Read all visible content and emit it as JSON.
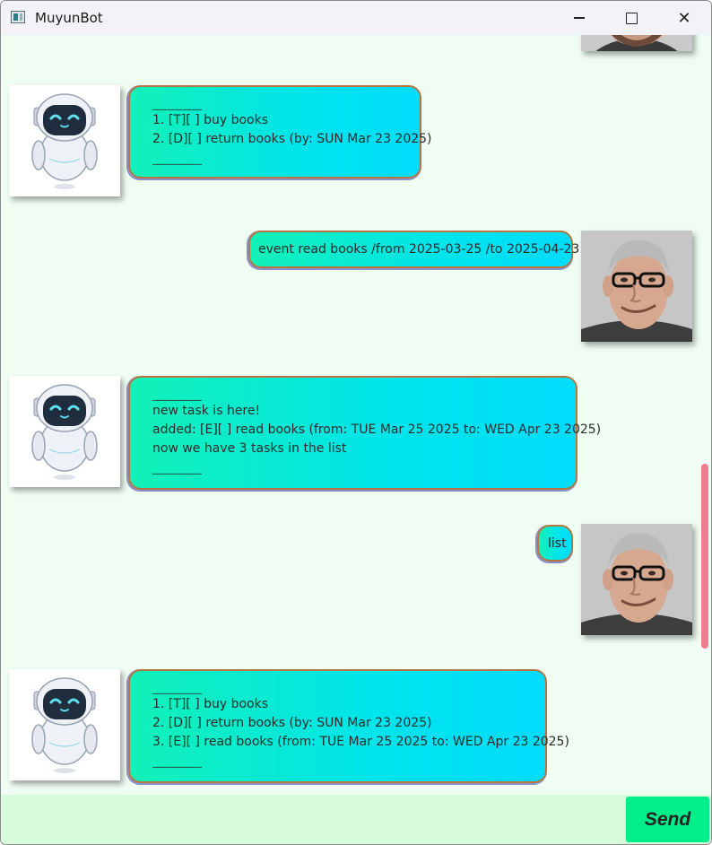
{
  "window": {
    "title": "MuyunBot",
    "icons": {
      "app": "app-window-icon",
      "minimize": "minimize-icon",
      "maximize": "maximize-icon",
      "close": "close-icon"
    },
    "close_glyph": "✕"
  },
  "colors": {
    "chat_bg": "#effdf2",
    "bubble_start": "#12f1b7",
    "bubble_end": "#00dcfb",
    "bubble_border": "#b27743",
    "send_button": "#00ef8a",
    "input_bg": "#d6fcdc",
    "scrollbar": "#f37a93"
  },
  "messages": [
    {
      "sender": "bot",
      "avatar": "robot-avatar",
      "lines": [
        "____________",
        "1. [T][ ] buy books",
        "2. [D][ ] return books (by: SUN Mar 23 2025)",
        "____________"
      ]
    },
    {
      "sender": "user",
      "avatar": "user-photo-avatar",
      "lines": [
        "event read books /from 2025-03-25 /to 2025-04-23"
      ]
    },
    {
      "sender": "bot",
      "avatar": "robot-avatar",
      "lines": [
        "____________",
        "new task is here!",
        "added: [E][ ] read books (from: TUE Mar 25 2025 to: WED Apr 23 2025)",
        "now we have 3 tasks in the list",
        "____________"
      ]
    },
    {
      "sender": "user",
      "avatar": "user-photo-avatar",
      "lines": [
        "list"
      ]
    },
    {
      "sender": "bot",
      "avatar": "robot-avatar",
      "lines": [
        "____________",
        "1. [T][ ] buy books",
        "2. [D][ ] return books (by: SUN Mar 23 2025)",
        "3. [E][ ] read books (from: TUE Mar 25 2025 to: WED Apr 23 2025)",
        "____________"
      ]
    }
  ],
  "input": {
    "value": "",
    "placeholder": ""
  },
  "send_button": {
    "label": "Send"
  }
}
